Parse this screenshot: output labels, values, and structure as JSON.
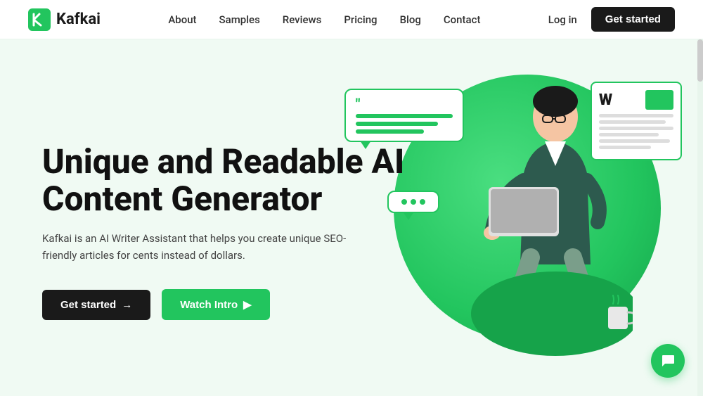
{
  "brand": {
    "name": "Kafkai",
    "logo_icon_color": "#22c55e"
  },
  "nav": {
    "links": [
      {
        "label": "About",
        "href": "#"
      },
      {
        "label": "Samples",
        "href": "#"
      },
      {
        "label": "Reviews",
        "href": "#"
      },
      {
        "label": "Pricing",
        "href": "#"
      },
      {
        "label": "Blog",
        "href": "#"
      },
      {
        "label": "Contact",
        "href": "#"
      }
    ],
    "login_label": "Log in",
    "get_started_label": "Get started"
  },
  "hero": {
    "title_line1": "Unique and Readable AI",
    "title_line2": "Content Generator",
    "subtitle": "Kafkai is an AI Writer Assistant that helps you create unique SEO-friendly articles for cents instead of dollars.",
    "btn_primary": "Get started",
    "btn_primary_arrow": "→",
    "btn_secondary": "Watch Intro",
    "btn_secondary_icon": "▶"
  },
  "chat_fab": {
    "icon": "💬"
  },
  "colors": {
    "green": "#22c55e",
    "dark": "#1a1a1a",
    "bg": "#f0faf3"
  }
}
